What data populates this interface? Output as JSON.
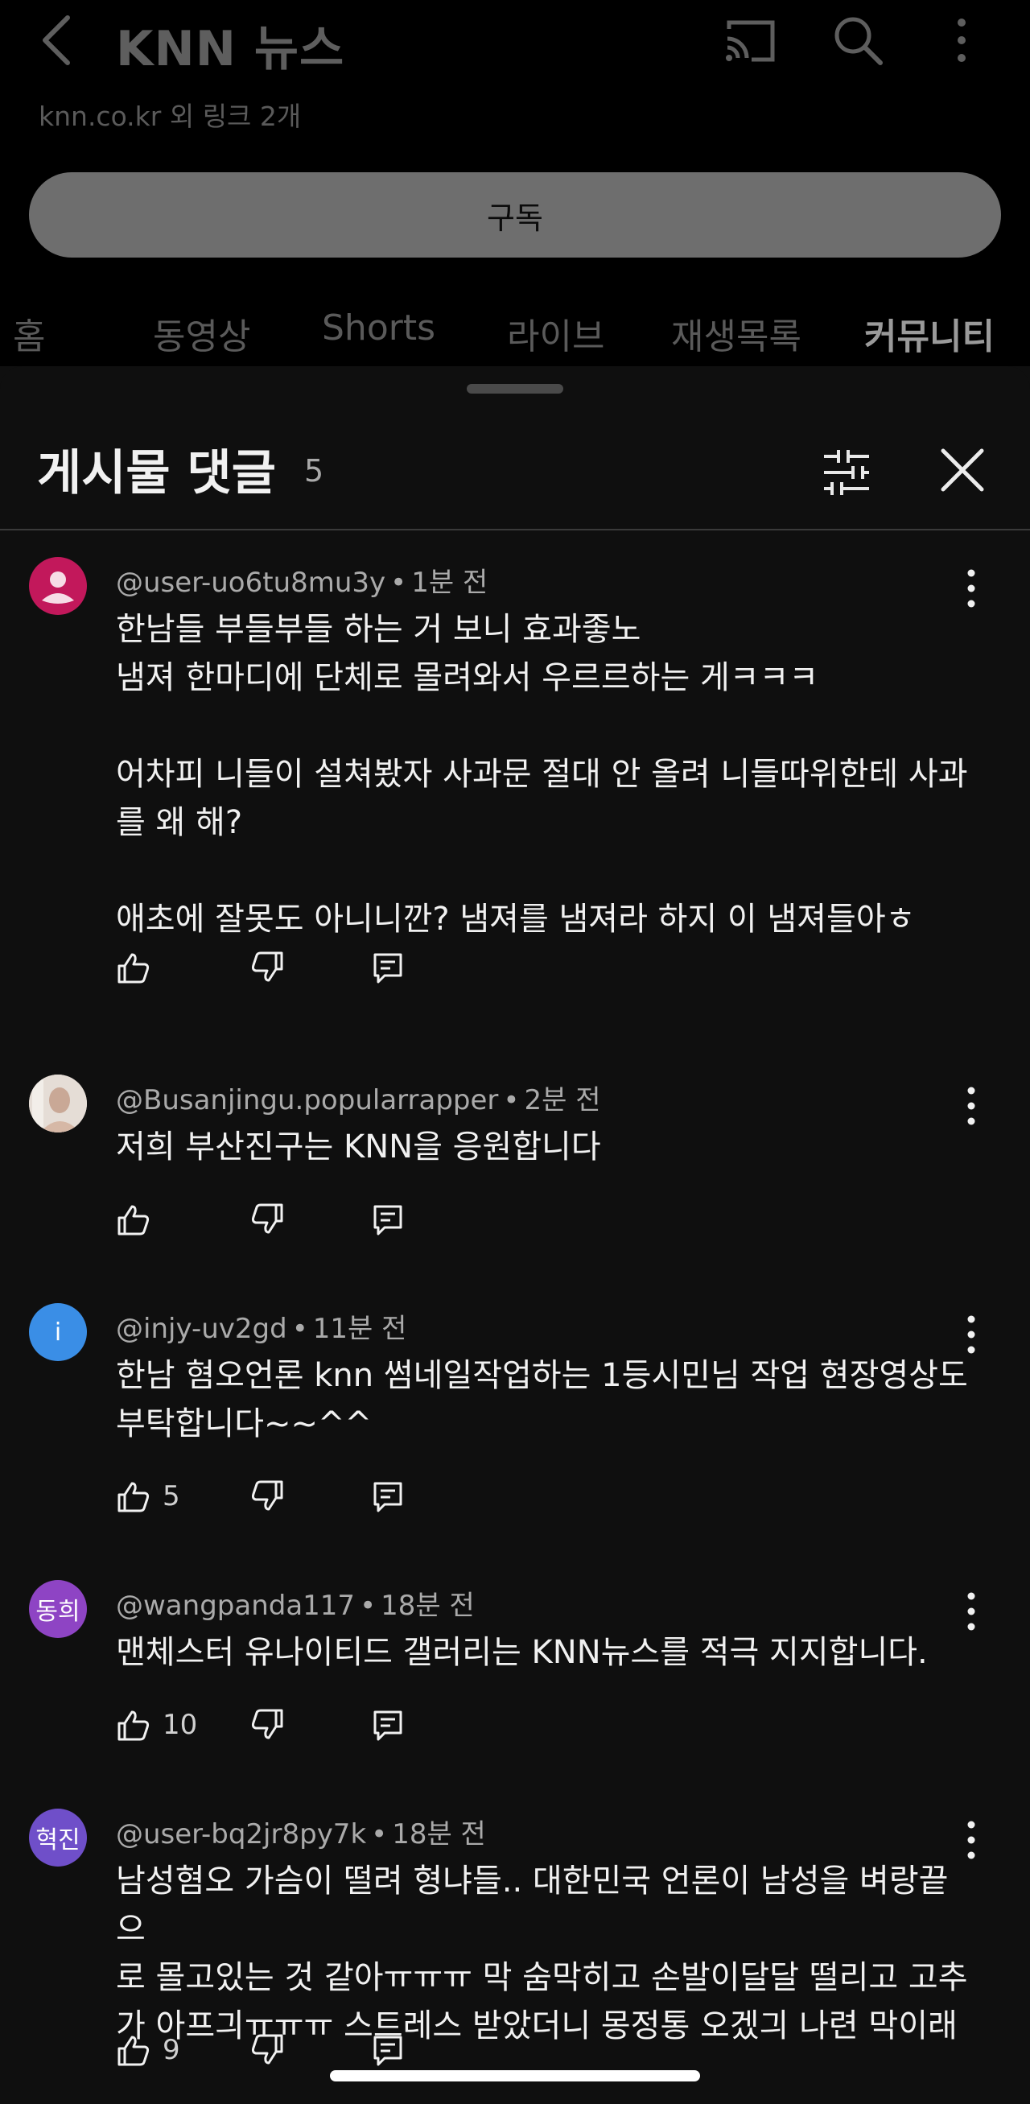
{
  "channel": {
    "title": "KNN 뉴스",
    "links_text": "knn.co.kr 외 링크 2개",
    "subscribe_label": "구독",
    "tabs": [
      {
        "label": "홈"
      },
      {
        "label": "동영상"
      },
      {
        "label": "Shorts"
      },
      {
        "label": "라이브"
      },
      {
        "label": "재생목록"
      },
      {
        "label": "커뮤니티"
      }
    ],
    "active_tab": "커뮤니티"
  },
  "sheet": {
    "title": "게시물 댓글",
    "count": "5"
  },
  "colors": {
    "background": "#0f0f0f",
    "text_primary": "#f1f1f1",
    "text_secondary": "#aaaaaa",
    "avatar_pink": "#c2185b",
    "avatar_blue": "#3a8ee6",
    "avatar_purple_1": "#8e44c4",
    "avatar_purple_2": "#6f4fc9"
  },
  "comments": [
    {
      "author": "@user-uo6tu8mu3y",
      "time": "1분 전",
      "lines": [
        "한남들 부들부들 하는 거 보니 효과좋노",
        "냄져 한마디에 단체로 몰려와서 우르르하는 게ㅋㅋㅋ",
        "",
        "어차피 니들이 설쳐봤자 사과문 절대 안 올려 니들따위한테 사과",
        "를 왜 해?",
        "",
        "애초에 잘못도 아니니깐? 냄져를 냄져라 하지 이 냄져들아ㅎ"
      ],
      "likes": "",
      "avatar_text": "",
      "avatar_icon": "person-icon"
    },
    {
      "author": "@Busanjingu.popularrapper",
      "time": "2분 전",
      "lines": [
        "저희 부산진구는 KNN을 응원합니다"
      ],
      "likes": "",
      "avatar_text": "",
      "avatar_icon": "photo-avatar"
    },
    {
      "author": "@injy-uv2gd",
      "time": "11분 전",
      "lines": [
        "한남 혐오언론 knn 썸네일작업하는 1등시민님 작업 현장영상도",
        "부탁합니다~~^^"
      ],
      "likes": "5",
      "avatar_text": "i",
      "avatar_icon": ""
    },
    {
      "author": "@wangpanda117",
      "time": "18분 전",
      "lines": [
        "맨체스터 유나이티드 갤러리는 KNN뉴스를 적극 지지합니다."
      ],
      "likes": "10",
      "avatar_text": "동희",
      "avatar_icon": ""
    },
    {
      "author": "@user-bq2jr8py7k",
      "time": "18분 전",
      "lines": [
        "남성혐오 가슴이 떨려 형냐들.. 대한민국 언론이 남성을 벼랑끝으",
        "로 몰고있는 것 같아ㅠㅠㅠ 막 숨막히고 손발이달달 떨리고 고추",
        "가 아프긔ㅠㅠㅠ 스트레스 받았더니 몽정통 오겠긔 나련 막이래"
      ],
      "likes": "9",
      "avatar_text": "혁진",
      "avatar_icon": ""
    }
  ]
}
